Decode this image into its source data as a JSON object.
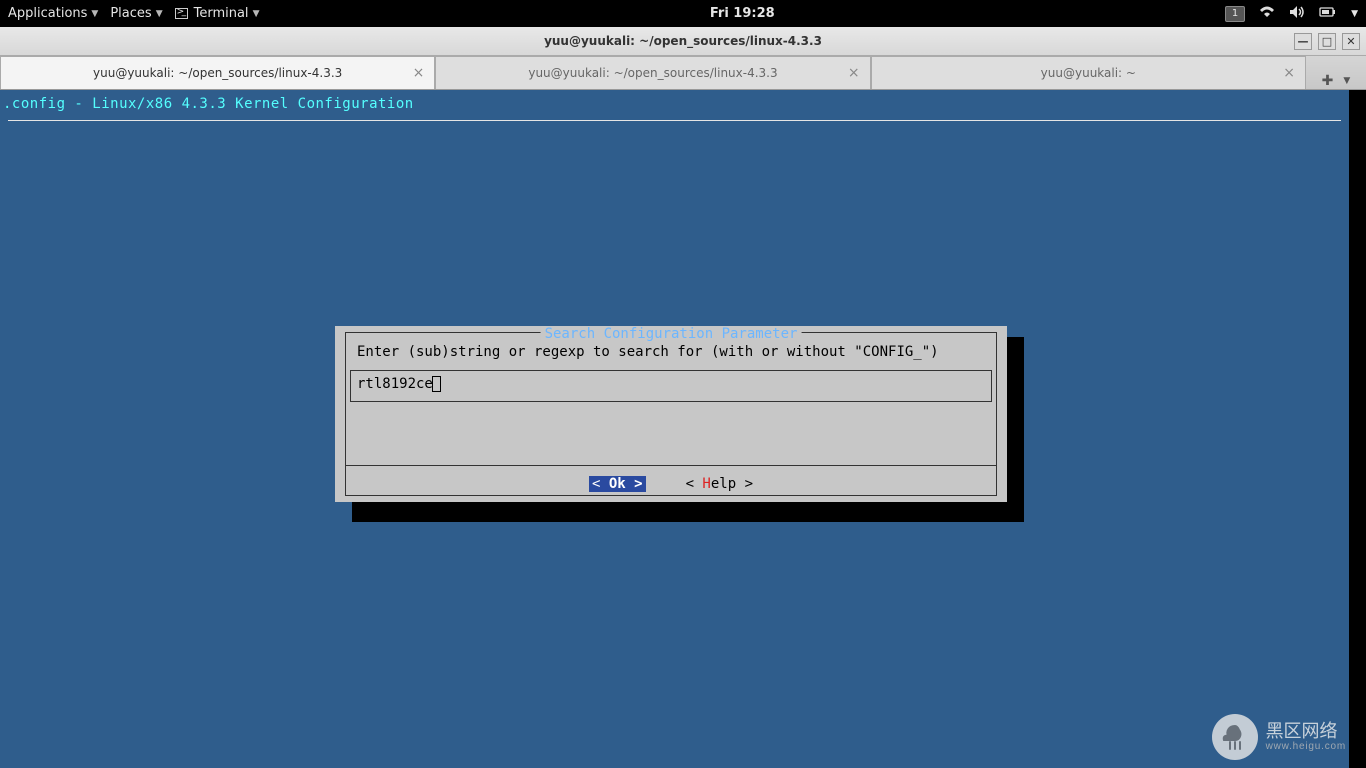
{
  "topbar": {
    "applications": "Applications",
    "places": "Places",
    "terminal": "Terminal",
    "clock": "Fri 19:28",
    "badge": "1"
  },
  "window": {
    "title": "yuu@yuukali: ~/open_sources/linux-4.3.3"
  },
  "tabs": [
    {
      "label": "yuu@yuukali: ~/open_sources/linux-4.3.3",
      "active": true
    },
    {
      "label": "yuu@yuukali: ~/open_sources/linux-4.3.3",
      "active": false
    },
    {
      "label": "yuu@yuukali: ~",
      "active": false
    }
  ],
  "terminal": {
    "config_line": ".config - Linux/x86 4.3.3 Kernel Configuration"
  },
  "dialog": {
    "title": " Search Configuration Parameter ",
    "prompt": "Enter (sub)string or regexp to search for (with or without \"CONFIG_\")",
    "input_value": "rtl8192ce",
    "ok_pre": "<  ",
    "ok_hk": "O",
    "ok_post": "k  >",
    "help_pre": "< ",
    "help_hk": "H",
    "help_post": "elp >"
  },
  "watermark": {
    "text": "黑区网络",
    "sub": "www.heigu.com"
  }
}
